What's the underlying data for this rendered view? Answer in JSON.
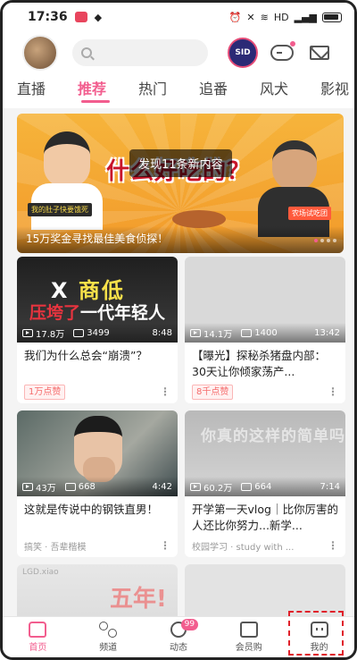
{
  "status_bar": {
    "time": "17:36",
    "network": "HD",
    "right_icons": [
      "alarm-icon",
      "mute-icon",
      "wifi-icon",
      "signal-icon",
      "battery-icon"
    ]
  },
  "header": {
    "avatar": "avatar",
    "search_placeholder": "",
    "game_logo_text": "SID",
    "icons": [
      "game-controller-icon",
      "mail-icon"
    ]
  },
  "tabs": [
    {
      "label": "直播",
      "active": false
    },
    {
      "label": "推荐",
      "active": true
    },
    {
      "label": "热门",
      "active": false
    },
    {
      "label": "追番",
      "active": false
    },
    {
      "label": "风犬",
      "active": false
    },
    {
      "label": "影视",
      "active": false
    }
  ],
  "banner": {
    "toast": "发现11条新内容",
    "headline": "什么好吃的？",
    "caption": "15万奖金寻找最佳美食侦探！",
    "tag_left": "我的肚子快要饿死",
    "tag_right": "农场试吃团",
    "current_index": 1,
    "dot_count": 4
  },
  "cards": [
    {
      "thumb_line1_a": "X",
      "thumb_line1_b": "商低",
      "thumb_line2_a": "压垮了",
      "thumb_line2_b": "一代年轻人",
      "views": "17.8万",
      "danmaku": "3499",
      "duration": "8:48",
      "title": "我们为什么总会“崩溃”？",
      "badge": "1万点赞",
      "source": ""
    },
    {
      "views": "14.1万",
      "danmaku": "1400",
      "duration": "13:42",
      "title": "【曝光】探秘杀猪盘内部：30天让你倾家荡产...",
      "badge": "8千点赞",
      "source": ""
    },
    {
      "views": "43万",
      "danmaku": "668",
      "duration": "4:42",
      "title": "这就是传说中的钢铁直男！",
      "badge": "",
      "source": "搞笑 · 吾辈楷模"
    },
    {
      "thumb_text": "你真的这样的简单吗",
      "views": "60.2万",
      "danmaku": "664",
      "duration": "7:14",
      "title": "开学第一天vlog｜比你厉害的人还比你努力...新学...",
      "badge": "",
      "source": "校园学习 · study with ..."
    },
    {
      "thumb_logo": "LGD.xiao",
      "thumb_text": "五年!",
      "title": "",
      "source": ""
    },
    {
      "title": "",
      "source": ""
    }
  ],
  "bottom_nav": [
    {
      "label": "首页",
      "icon": "home-icon",
      "active": true
    },
    {
      "label": "频道",
      "icon": "channel-icon",
      "active": false
    },
    {
      "label": "动态",
      "icon": "dynamic-icon",
      "active": false,
      "badge": "99"
    },
    {
      "label": "会员购",
      "icon": "vip-shop-icon",
      "active": false
    },
    {
      "label": "我的",
      "icon": "mine-icon",
      "active": false
    }
  ],
  "colors": {
    "accent": "#f25d8e",
    "highlight": "#e0202a"
  }
}
